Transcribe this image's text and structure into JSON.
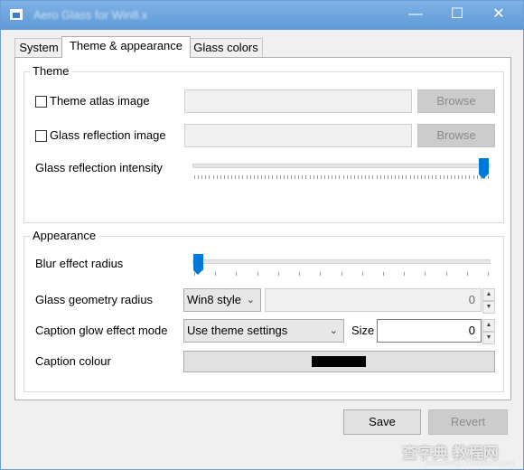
{
  "window": {
    "title": "Aero Glass for Win8.x",
    "min_glyph": "—",
    "max_glyph": "☐",
    "close_glyph": "✕"
  },
  "tabs": [
    {
      "label": "System",
      "active": false
    },
    {
      "label": "Theme & appearance",
      "active": true
    },
    {
      "label": "Glass colors",
      "active": false
    }
  ],
  "theme": {
    "group_label": "Theme",
    "atlas": {
      "label": "Theme atlas image",
      "checked": false,
      "value": "",
      "browse_label": "Browse",
      "browse_enabled": false
    },
    "reflection": {
      "label": "Glass reflection image",
      "checked": false,
      "value": "",
      "browse_label": "Browse",
      "browse_enabled": false
    },
    "intensity": {
      "label": "Glass reflection intensity",
      "level": 1.0
    }
  },
  "appearance": {
    "group_label": "Appearance",
    "blur": {
      "label": "Blur effect radius",
      "level": 0.0
    },
    "geometry": {
      "label": "Glass geometry radius",
      "style": "Win8 style",
      "value": "0"
    },
    "glow": {
      "label": "Caption glow effect mode",
      "mode": "Use theme settings",
      "size_label": "Size",
      "size_value": "0"
    },
    "caption_colour": {
      "label": "Caption colour",
      "color": "#000000"
    }
  },
  "footer": {
    "save_label": "Save",
    "revert_label": "Revert",
    "revert_enabled": false
  },
  "watermark": {
    "text": "查字典 教程网",
    "sub": "jiaocheng.chazidian.com"
  },
  "colors": {
    "accent": "#0078d7",
    "titlebar": "#6aa3dc"
  }
}
